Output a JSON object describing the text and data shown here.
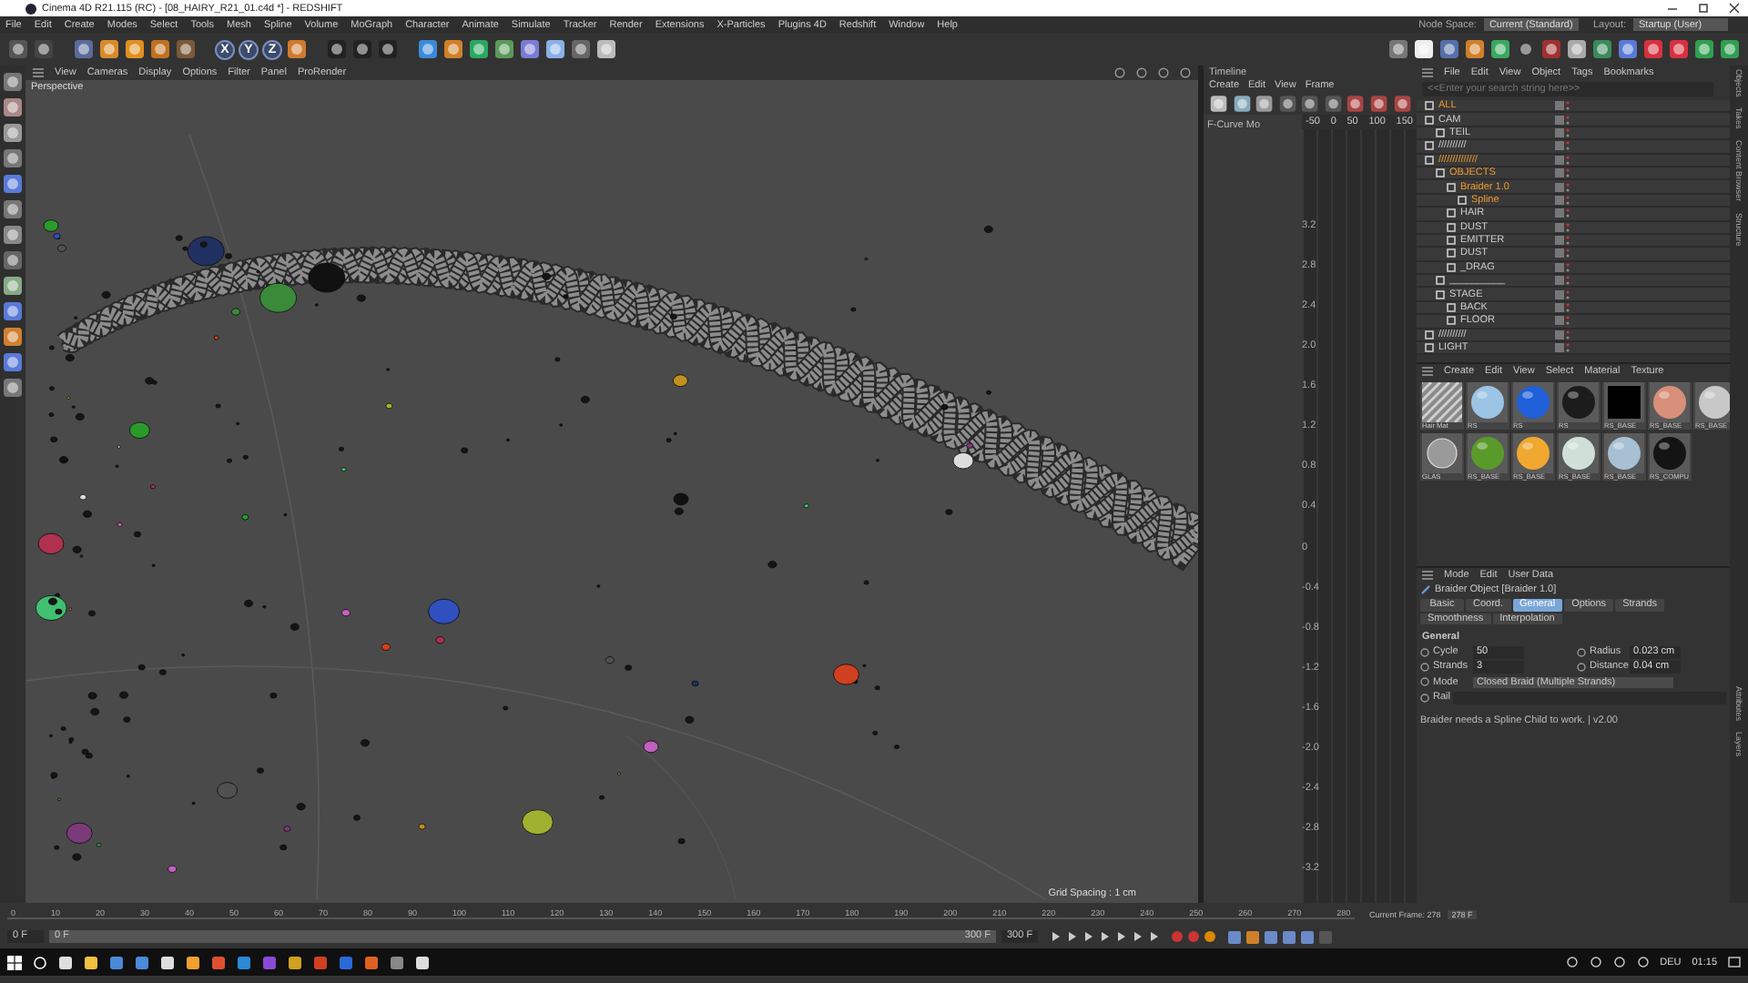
{
  "window": {
    "title": "Cinema 4D R21.115 (RC) - [08_HAIRY_R21_01.c4d *] - REDSHIFT"
  },
  "menu_bar": [
    "File",
    "Edit",
    "Create",
    "Modes",
    "Select",
    "Tools",
    "Mesh",
    "Spline",
    "Volume",
    "MoGraph",
    "Character",
    "Animate",
    "Simulate",
    "Tracker",
    "Render",
    "Extensions",
    "X-Particles",
    "Plugins 4D",
    "Redshift",
    "Window",
    "Help"
  ],
  "node_space": {
    "label": "Node Space:",
    "value": "Current (Standard)"
  },
  "layout": {
    "label": "Layout:",
    "value": "Startup (User)"
  },
  "axis_buttons": [
    "X",
    "Y",
    "Z"
  ],
  "viewport": {
    "menu": [
      "View",
      "Cameras",
      "Display",
      "Options",
      "Filter",
      "Panel",
      "ProRender"
    ],
    "camera": "Perspective",
    "grid_spacing": "Grid Spacing : 1 cm"
  },
  "timeline": {
    "title": "Timeline",
    "menu": [
      "Create",
      "Edit",
      "View",
      "Frame"
    ],
    "track": "F-Curve Mo",
    "ruler": [
      "-50",
      "0",
      "50",
      "100",
      "150"
    ],
    "values": [
      "3.2",
      "2.8",
      "2.4",
      "2.0",
      "1.6",
      "1.2",
      "0.8",
      "0.4",
      "0",
      "-0.4",
      "-0.8",
      "-1.2",
      "-1.6",
      "-2.0",
      "-2.4",
      "-2.8",
      "-3.2"
    ]
  },
  "object_manager": {
    "menu": [
      "File",
      "Edit",
      "View",
      "Object",
      "Tags",
      "Bookmarks"
    ],
    "search": {
      "placeholder": "<<Enter your search string here>>"
    },
    "objects": [
      {
        "name": "ALL",
        "selected": true
      },
      {
        "name": "CAM",
        "selected": false,
        "children": [
          {
            "name": "TEIL",
            "selected": false
          }
        ]
      },
      {
        "name": "//////////",
        "selected": false
      },
      {
        "name": "//////////////",
        "selected": true,
        "children": [
          {
            "name": "OBJECTS",
            "selected": true,
            "children": [
              {
                "name": "Braider 1.0",
                "selected": true,
                "children": [
                  {
                    "name": "Spline",
                    "selected": true
                  }
                ]
              },
              {
                "name": "HAIR",
                "selected": false
              },
              {
                "name": "DUST",
                "selected": false
              },
              {
                "name": "EMITTER",
                "selected": false
              },
              {
                "name": "DUST",
                "selected": false
              },
              {
                "name": "_DRAG",
                "selected": false
              }
            ]
          },
          {
            "name": "__________",
            "selected": false
          },
          {
            "name": "STAGE",
            "selected": false,
            "children": [
              {
                "name": "BACK",
                "selected": false
              },
              {
                "name": "FLOOR",
                "selected": false
              }
            ]
          }
        ]
      },
      {
        "name": "//////////",
        "selected": false
      },
      {
        "name": "LIGHT",
        "selected": false
      }
    ]
  },
  "side_tabs": [
    "Objects",
    "Takes",
    "Content Browser",
    "Structure"
  ],
  "side_tabs_lower": [
    "Attributes",
    "Layers"
  ],
  "materials": {
    "menu": [
      "Create",
      "Edit",
      "View",
      "Select",
      "Material",
      "Texture"
    ],
    "items": [
      {
        "name": "Hair Mat",
        "kind": "stripes",
        "color": "#8a8a8a"
      },
      {
        "name": "RS",
        "kind": "sphere",
        "color": "#9cc4e4"
      },
      {
        "name": "RS",
        "kind": "sphere",
        "color": "#1f5fd8"
      },
      {
        "name": "RS",
        "kind": "sphere",
        "color": "#1c1c1c"
      },
      {
        "name": "RS_BASE",
        "kind": "flat",
        "color": "#000000"
      },
      {
        "name": "RS_BASE",
        "kind": "sphere",
        "color": "#d8907a"
      },
      {
        "name": "RS_BASE",
        "kind": "sphere",
        "color": "#c8c8c8"
      },
      {
        "name": "GLAS",
        "kind": "glass",
        "color": "#9a9a9a"
      },
      {
        "name": "RS_BASE",
        "kind": "sphere",
        "color": "#5a9a2a"
      },
      {
        "name": "RS_BASE",
        "kind": "sphere",
        "color": "#f0a830"
      },
      {
        "name": "RS_BASE",
        "kind": "sphere",
        "color": "#cfe0d8"
      },
      {
        "name": "RS_BASE",
        "kind": "sphere",
        "color": "#a8c0d4"
      },
      {
        "name": "RS_COMPU",
        "kind": "sphere",
        "color": "#141414"
      }
    ]
  },
  "attributes": {
    "menu": [
      "Mode",
      "Edit",
      "User Data"
    ],
    "object": "Braider Object [Braider 1.0]",
    "tabs": [
      {
        "label": "Basic",
        "selected": false
      },
      {
        "label": "Coord.",
        "selected": false
      },
      {
        "label": "General",
        "selected": true
      },
      {
        "label": "Options",
        "selected": false
      },
      {
        "label": "Strands",
        "selected": false
      },
      {
        "label": "Smoothness",
        "selected": false
      },
      {
        "label": "Interpolation",
        "selected": false
      }
    ],
    "section": "General",
    "fields": [
      {
        "label": "Cycle",
        "value": "50"
      },
      {
        "label": "Radius",
        "value": "0.023 cm"
      },
      {
        "label": "Strands",
        "value": "3"
      },
      {
        "label": "Distance",
        "value": "0.04 cm"
      }
    ],
    "mode": {
      "label": "Mode",
      "value": "Closed Braid (Multiple Strands)"
    },
    "rail": {
      "label": "Rail"
    },
    "message": "Braider needs a Spline Child to work. | v2.00"
  },
  "animation": {
    "ruler": [
      "0",
      "10",
      "20",
      "30",
      "40",
      "50",
      "60",
      "70",
      "80",
      "90",
      "100",
      "110",
      "120",
      "130",
      "140",
      "150",
      "160",
      "170",
      "180",
      "190",
      "200",
      "210",
      "220",
      "230",
      "240",
      "250",
      "260",
      "270",
      "280"
    ],
    "current_frame": "Current Frame: 278",
    "end_marker": "278 F",
    "start": "0 F",
    "range": {
      "start": "0 F",
      "end": "300 F",
      "level": 1
    },
    "end": "300 F"
  },
  "taskbar": {
    "language": "DEU",
    "time": "01:15"
  }
}
